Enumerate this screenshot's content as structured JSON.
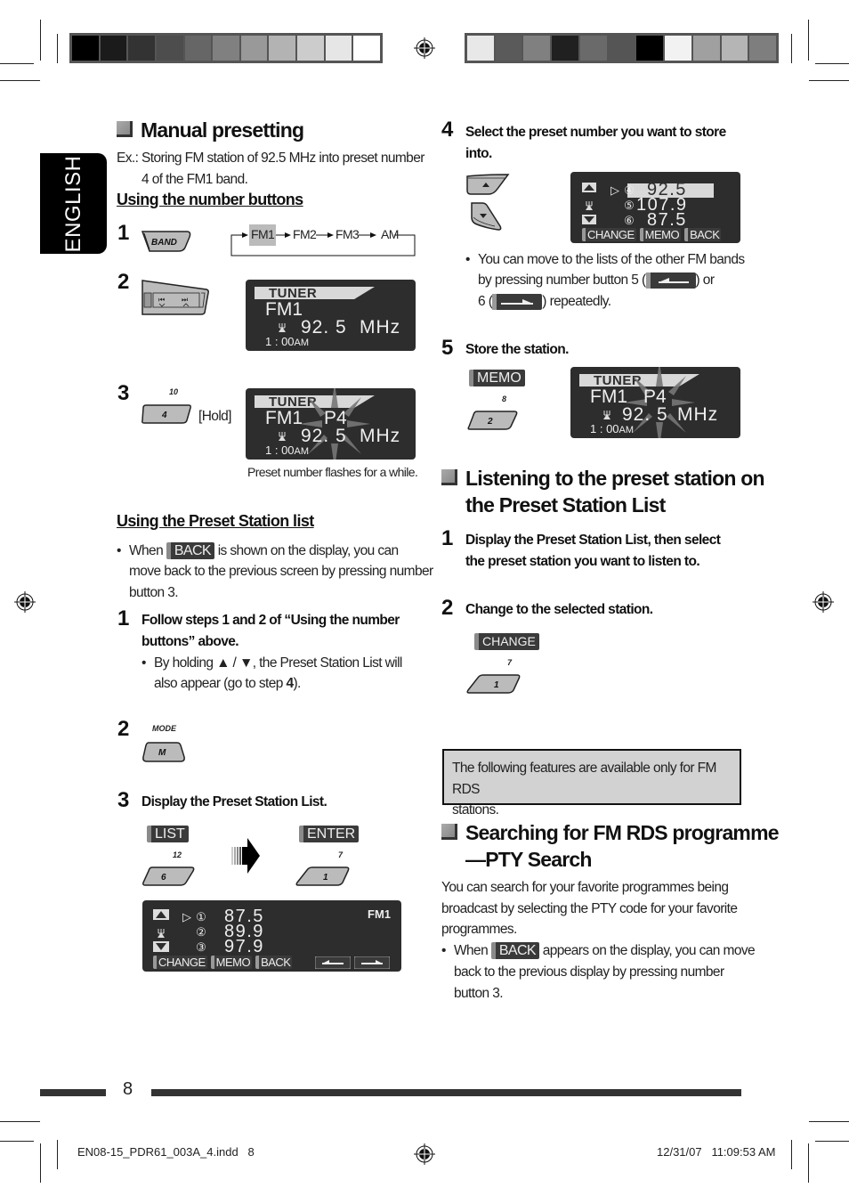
{
  "language_tab": "ENGLISH",
  "page_number": "8",
  "footer": {
    "file_name": "EN08-15_PDR61_003A_4.indd   8",
    "timestamp": "12/31/07   11:09:53 AM"
  },
  "color_bars": {
    "left": [
      "#000000",
      "#1b1b1b",
      "#333333",
      "#4d4d4d",
      "#666666",
      "#808080",
      "#999999",
      "#b3b3b3",
      "#cccccc",
      "#e6e6e6",
      "#ffffff"
    ],
    "right": [
      "#e8e8e8",
      "#5a5a5a",
      "#808080",
      "#202020",
      "#6a6a6a",
      "#555555",
      "#000000",
      "#f2f2f2",
      "#a0a0a0",
      "#b5b5b5",
      "#7e7e7e"
    ]
  },
  "manual_presetting": {
    "title": "Manual presetting",
    "example_prefix": "Ex.:",
    "example_text_1": "Storing FM station of 92.5 MHz into preset number",
    "example_text_2": "4 of the FM1 band.",
    "number_buttons": {
      "heading": "Using the number buttons",
      "step1": {
        "num": "1",
        "button": "BAND",
        "cycle": [
          "FM1",
          "FM2",
          "FM3",
          "AM"
        ],
        "cycle_selected": "FM1"
      },
      "step2": {
        "num": "2",
        "display": {
          "tuner": "TUNER",
          "band": "FM1",
          "freq": "92. 5",
          "unit": "MHz",
          "clock": "1 : 00",
          "ampm": "AM"
        }
      },
      "step3": {
        "num": "3",
        "button_top_label": "10",
        "button": "4",
        "hold_label": "[Hold]",
        "display": {
          "tuner": "TUNER",
          "band": "FM1",
          "preset": "P4",
          "freq": "92. 5",
          "unit": "MHz",
          "clock": "1 : 00",
          "ampm": "AM"
        },
        "caption": "Preset number flashes for a while."
      }
    },
    "preset_list": {
      "heading": "Using the Preset Station list",
      "bullet_pre": "When",
      "bullet_chip": "BACK",
      "bullet_post_1": "is shown on the display, you can",
      "bullet_line_2": "move back to the previous screen by pressing number",
      "bullet_line_3": "button 3.",
      "step1": {
        "num": "1",
        "text_1": "Follow steps 1 and 2 of “Using the number",
        "text_2": "buttons” above.",
        "sub_bullet_1": "By holding ▲ / ▼, the Preset Station List will",
        "sub_bullet_2_pre": "also appear (go to step ",
        "sub_bullet_2_bold": "4",
        "sub_bullet_2_post": ")."
      },
      "step2": {
        "num": "2",
        "button_top_label": "MODE",
        "button": "M"
      },
      "step3": {
        "num": "3",
        "text": "Display the Preset Station List.",
        "left_softkey": "LIST",
        "left_top_label": "12",
        "left_button": "6",
        "right_softkey": "ENTER",
        "right_top_label": "7",
        "right_button": "1",
        "display": {
          "band": "FM1",
          "rows": [
            {
              "marker": "▷",
              "num": "①",
              "freq": "87.5"
            },
            {
              "marker": "",
              "num": "②",
              "freq": "89.9"
            },
            {
              "marker": "",
              "num": "③",
              "freq": "97.9"
            }
          ],
          "softkeys": [
            "CHANGE",
            "MEMO",
            "BACK"
          ]
        }
      }
    }
  },
  "step4": {
    "num": "4",
    "text_1": "Select the preset number you want to store",
    "text_2": "into.",
    "display": {
      "rows": [
        {
          "marker": "▷",
          "num": "④",
          "freq": "92.5",
          "selected": true
        },
        {
          "marker": "",
          "num": "⑤",
          "freq": "107.9",
          "selected": false
        },
        {
          "marker": "",
          "num": "⑥",
          "freq": "87.5",
          "selected": false
        }
      ],
      "softkeys": [
        "CHANGE",
        "MEMO",
        "BACK"
      ]
    },
    "bullet_1": "You can move to the lists of the other FM bands",
    "bullet_2_pre": "by pressing number button 5 (",
    "bullet_2_post": ") or",
    "bullet_3_pre": "6 (",
    "bullet_3_post": ") repeatedly."
  },
  "step5": {
    "num": "5",
    "text": "Store the station.",
    "softkey": "MEMO",
    "button_top_label": "8",
    "button": "2",
    "display": {
      "tuner": "TUNER",
      "band": "FM1",
      "preset": "P4",
      "freq": "92. 5",
      "unit": "MHz",
      "clock": "1 : 00",
      "ampm": "AM"
    }
  },
  "listening": {
    "title_1": "Listening to the preset station on",
    "title_2": "the Preset Station List",
    "step1": {
      "num": "1",
      "text_1": "Display the Preset Station List, then select",
      "text_2": "the preset station you want to listen to."
    },
    "step2": {
      "num": "2",
      "text": "Change to the selected station.",
      "softkey": "CHANGE",
      "button_top_label": "7",
      "button": "1"
    }
  },
  "note": {
    "line_1": "The following features are available only for FM RDS",
    "line_2": "stations."
  },
  "pty": {
    "title_1": "Searching for FM RDS programme",
    "title_2": "—PTY Search",
    "body_1": "You can search for your favorite programmes being",
    "body_2": "broadcast by selecting the PTY code for your favorite",
    "body_3": "programmes.",
    "bullet_pre": "When",
    "bullet_chip": "BACK",
    "bullet_post_1": "appears on the display, you can move",
    "bullet_line_2": "back to the previous display by pressing number",
    "bullet_line_3": "button 3."
  }
}
